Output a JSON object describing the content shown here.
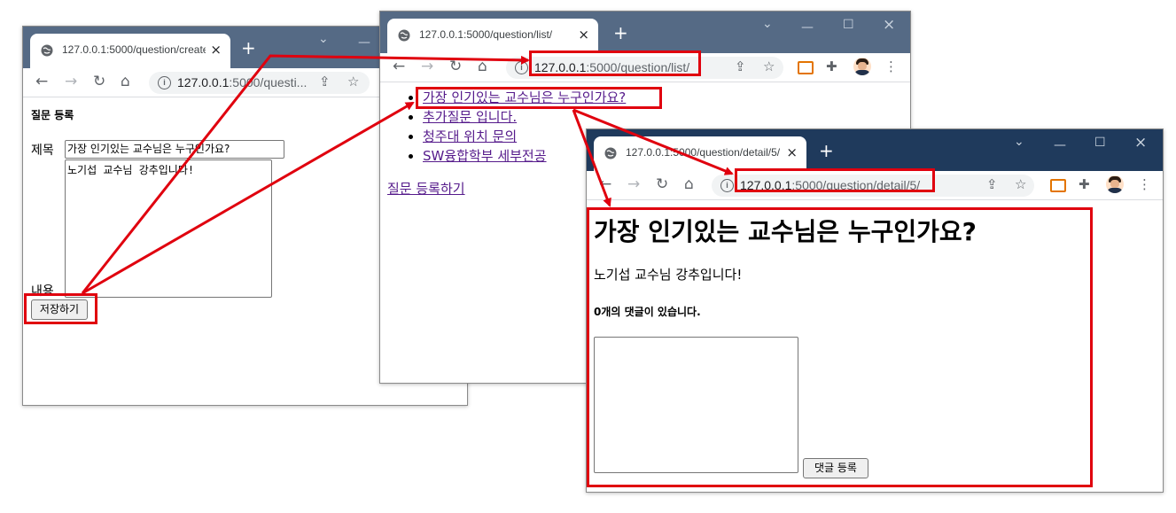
{
  "windows": {
    "create": {
      "tab_title": "127.0.0.1:5000/question/create",
      "address_host": "127.0.0.1",
      "address_rest": ":5000/questi...",
      "heading": "질문 등록",
      "subject_label": "제목",
      "subject_value": "가장 인기있는 교수님은 누구인가요?",
      "content_label": "내용",
      "content_value": "노기섭 교수님 강추입니다!",
      "save_button": "저장하기",
      "titlebar_color": "#556a85"
    },
    "list": {
      "tab_title": "127.0.0.1:5000/question/list/",
      "address_host": "127.0.0.1",
      "address_rest": ":5000/question/list/",
      "questions": [
        "가장 인기있는 교수님은 누구인가요?",
        "추가질문 입니다.",
        "청주대 위치 문의",
        "SW융합학부 세부전공"
      ],
      "register_link": "질문 등록하기",
      "titlebar_color": "#556a85"
    },
    "detail": {
      "tab_title": "127.0.0.1:5000/question/detail/5/",
      "address_host": "127.0.0.1",
      "address_rest": ":5000/question/detail/5/",
      "subject": "가장 인기있는 교수님은 누구인가요?",
      "content": "노기섭 교수님 강추입니다!",
      "answer_count": "0개의 댓글이 있습니다.",
      "answer_button": "댓글 등록",
      "titlebar_color": "#1f3a5c"
    }
  },
  "icons": {
    "back": "←",
    "forward": "→",
    "reload": "↻",
    "home": "⌂",
    "star": "☆",
    "share": "⇪",
    "close": "×",
    "new_tab": "+",
    "minimize": "—",
    "maximize": "☐",
    "chevron": "⌄",
    "extensions": "✚",
    "menu": "⋮",
    "info": "i"
  },
  "colors": {
    "annotation_red": "#e0000e",
    "link_visited": "#551a8b"
  }
}
